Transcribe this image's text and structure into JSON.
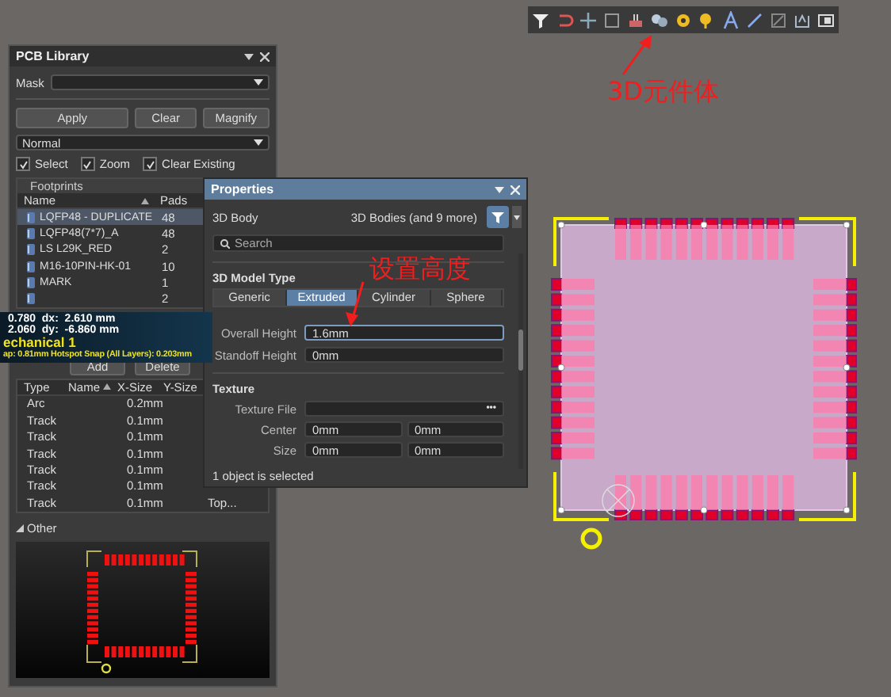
{
  "annotations": [
    {
      "text": "3D元件体"
    },
    {
      "text": "设置高度"
    }
  ],
  "pcb_library": {
    "title": "PCB Library",
    "mask": {
      "label": "Mask"
    },
    "buttons": [
      "Apply",
      "Clear",
      "Magnify"
    ],
    "mode": "Normal",
    "options": [
      {
        "label": "Select",
        "checked": true
      },
      {
        "label": "Zoom",
        "checked": true
      },
      {
        "label": "Clear Existing",
        "checked": true
      }
    ],
    "footprints": {
      "header": "Footprints",
      "columns": [
        "Name",
        "Pads"
      ],
      "rows": [
        {
          "name": "LQFP48 - DUPLICATE",
          "pads": "48",
          "selected": true
        },
        {
          "name": "LQFP48(7*7)_A",
          "pads": "48",
          "selected": false
        },
        {
          "name": "LS L29K_RED",
          "pads": "2",
          "selected": false
        },
        {
          "name": "M16-10PIN-HK-01",
          "pads": "10",
          "selected": false
        },
        {
          "name": "MARK",
          "pads": "1",
          "selected": false
        },
        {
          "pads": "2",
          "selected": false
        }
      ]
    },
    "footprint_buttons": [
      "Add",
      "Delete"
    ],
    "primitives": {
      "columns": [
        "Type",
        "Name",
        "X-Size",
        "Y-Size"
      ],
      "rows": [
        {
          "type": "Arc",
          "x_size": "0.2mm"
        },
        {
          "type": "Track",
          "x_size": "0.1mm"
        },
        {
          "type": "Track",
          "x_size": "0.1mm"
        },
        {
          "type": "Track",
          "x_size": "0.1mm"
        },
        {
          "type": "Track",
          "x_size": "0.1mm"
        },
        {
          "type": "Track",
          "x_size": "0.1mm"
        },
        {
          "type": "Track",
          "x_size": "0.1mm",
          "column_5": "Top..."
        }
      ]
    },
    "other": {
      "label": "Other",
      "expanded": true
    }
  },
  "tooltip": {
    "lines": [
      {
        "kind": "coord",
        "text": "0.780  dx:  2.610 mm"
      },
      {
        "kind": "coord",
        "text": "2.060  dy:  -6.860 mm"
      },
      {
        "kind": "layer",
        "text": "echanical 1"
      },
      {
        "kind": "snap",
        "text": "ap: 0.81mm Hotspot Snap (All Layers): 0.203mm"
      }
    ]
  },
  "properties": {
    "title": "Properties",
    "object": "3D Body",
    "scope": "3D Bodies (and 9 more)",
    "search": {
      "placeholder": "Search"
    },
    "model_type": {
      "heading": "3D Model Type",
      "options": [
        {
          "label": "Generic",
          "selected": false
        },
        {
          "label": "Extruded",
          "selected": true
        },
        {
          "label": "Cylinder",
          "selected": false
        },
        {
          "label": "Sphere",
          "selected": false
        }
      ]
    },
    "fields": [
      {
        "label": "Overall Height",
        "value": "1.6mm",
        "focused": true
      },
      {
        "label": "Standoff Height",
        "value": "0mm",
        "focused": false
      }
    ],
    "texture": {
      "heading": "Texture",
      "file_label": "Texture File",
      "browse": "•••",
      "rows": [
        {
          "label": "Center",
          "values": [
            "0mm",
            "0mm"
          ]
        },
        {
          "label": "Size",
          "values": [
            "0mm",
            "0mm"
          ]
        }
      ]
    },
    "status": "1 object is selected"
  }
}
